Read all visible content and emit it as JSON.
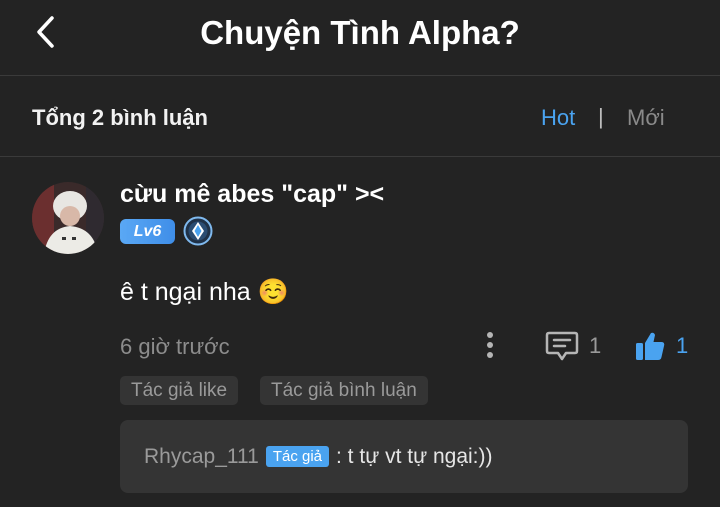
{
  "header": {
    "title": "Chuyện Tình Alpha?",
    "back_icon": "chevron-left-icon"
  },
  "comments_bar": {
    "total_label": "Tổng 2 bình luận",
    "sort_hot": "Hot",
    "separator": "|",
    "sort_new": "Mới",
    "active_sort": "Hot",
    "active_color": "#4aa3f0"
  },
  "comment": {
    "username": "cừu mê abes \"cap\" ><",
    "level_badge": "Lv6",
    "vip_icon": "vip-diamond-icon",
    "text": "ê t ngại nha ☺️",
    "time": "6 giờ trước",
    "reply_count": "1",
    "like_count": "1",
    "tags": [
      "Tác giả like",
      "Tác giả bình luận"
    ],
    "reply": {
      "user": "Rhycap_111",
      "badge": "Tác giả",
      "text": ": t tự vt tự ngại:))"
    }
  }
}
